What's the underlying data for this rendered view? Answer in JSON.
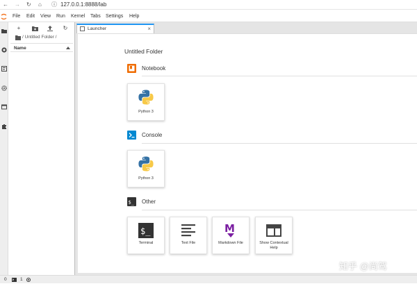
{
  "browser": {
    "url": "127.0.0.1:8888/lab"
  },
  "menu": [
    "File",
    "Edit",
    "View",
    "Run",
    "Kernel",
    "Tabs",
    "Settings",
    "Help"
  ],
  "file_browser": {
    "breadcrumb": "/ Untitled Folder /",
    "column_name": "Name"
  },
  "tab": {
    "label": "Launcher",
    "close": "×"
  },
  "launcher": {
    "folder": "Untitled Folder",
    "notebook": {
      "title": "Notebook",
      "cards": [
        {
          "label": "Python 3",
          "icon": "python-icon"
        }
      ]
    },
    "console": {
      "title": "Console",
      "cards": [
        {
          "label": "Python 3",
          "icon": "python-icon"
        }
      ]
    },
    "other": {
      "title": "Other",
      "cards": [
        {
          "label": "Terminal",
          "icon": "terminal-icon"
        },
        {
          "label": "Text File",
          "icon": "text-file-icon"
        },
        {
          "label": "Markdown File",
          "icon": "markdown-icon"
        },
        {
          "label": "Show Contextual Help",
          "icon": "contextual-help-icon"
        }
      ]
    }
  },
  "status": {
    "terminals": "0",
    "kernels": "1"
  },
  "watermark": "知乎 @尚驾",
  "colors": {
    "accent": "#2196f3",
    "notebook": "#ef6c00",
    "console": "#0288d1",
    "markdown": "#7b1fa2"
  }
}
